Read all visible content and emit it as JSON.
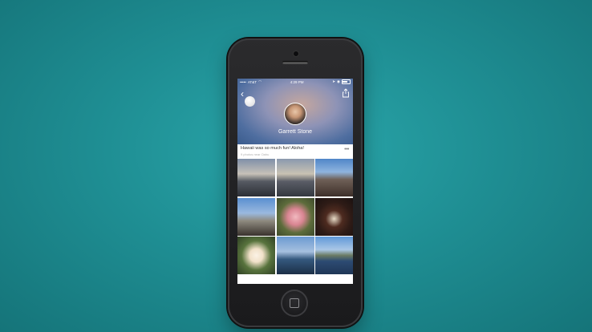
{
  "status_bar": {
    "carrier": "AT&T",
    "time": "4:29 PM"
  },
  "profile": {
    "name": "Garrett Stone"
  },
  "album": {
    "title": "Hawaii was so much fun! Aloha!",
    "subtitle": "9 photos near Oahu"
  },
  "photos": [
    {
      "icon": "photo-sunset-shore"
    },
    {
      "icon": "photo-road-sunset"
    },
    {
      "icon": "photo-rocky-beach"
    },
    {
      "icon": "photo-beach-clouds"
    },
    {
      "icon": "photo-pink-hibiscus"
    },
    {
      "icon": "photo-chocolate-dessert"
    },
    {
      "icon": "photo-plumeria-flowers"
    },
    {
      "icon": "photo-boat-flag"
    },
    {
      "icon": "photo-ocean-view"
    }
  ],
  "colors": {
    "background": "#1f8f94",
    "header_blue": "#4f6ea0"
  }
}
